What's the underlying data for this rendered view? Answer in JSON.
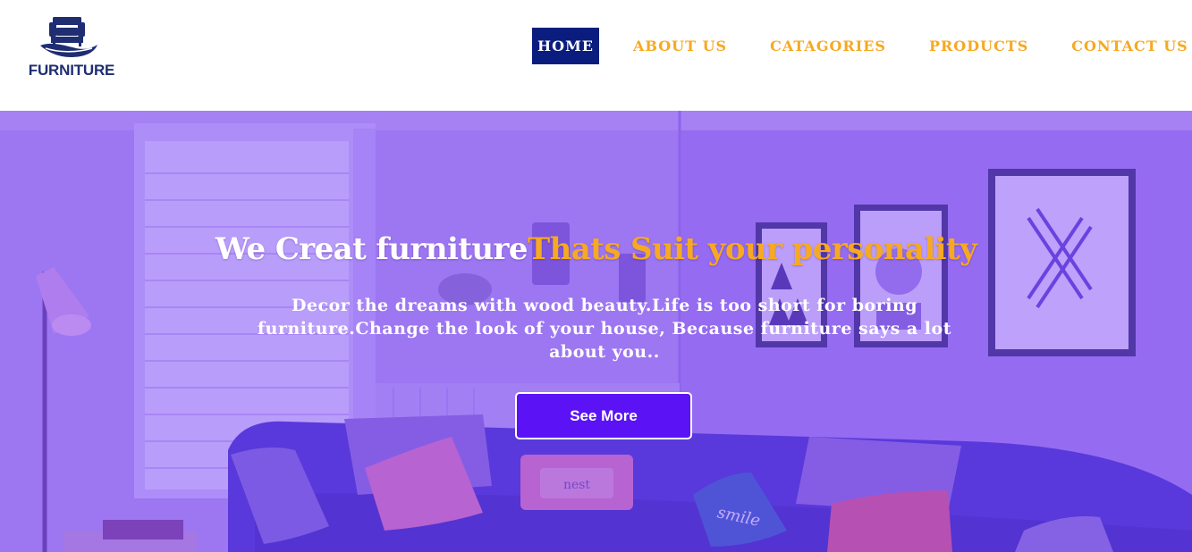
{
  "brand": {
    "name": "FURNITURE",
    "color": "#1f2d72"
  },
  "nav": {
    "items": [
      {
        "label": "HOME",
        "active": true
      },
      {
        "label": "ABOUT US",
        "active": false
      },
      {
        "label": "CATAGORIES",
        "active": false
      },
      {
        "label": "PRODUCTS",
        "active": false
      },
      {
        "label": "CONTACT US",
        "active": false
      }
    ],
    "active_bg": "#0a1d7e",
    "link_color": "#f6a922"
  },
  "hero": {
    "title_part1": "We Creat furniture",
    "title_part2": "Thats Suit your personality",
    "description": "Decor the dreams with wood beauty.Life is too short for boring furniture.Change the look of your house, Because furniture says a lot about you..",
    "cta_label": "See More",
    "overlay_color": "#7d46f5",
    "cta_color": "#5b13f5",
    "pillow_text_1": "nest",
    "pillow_text_2": "smile"
  }
}
